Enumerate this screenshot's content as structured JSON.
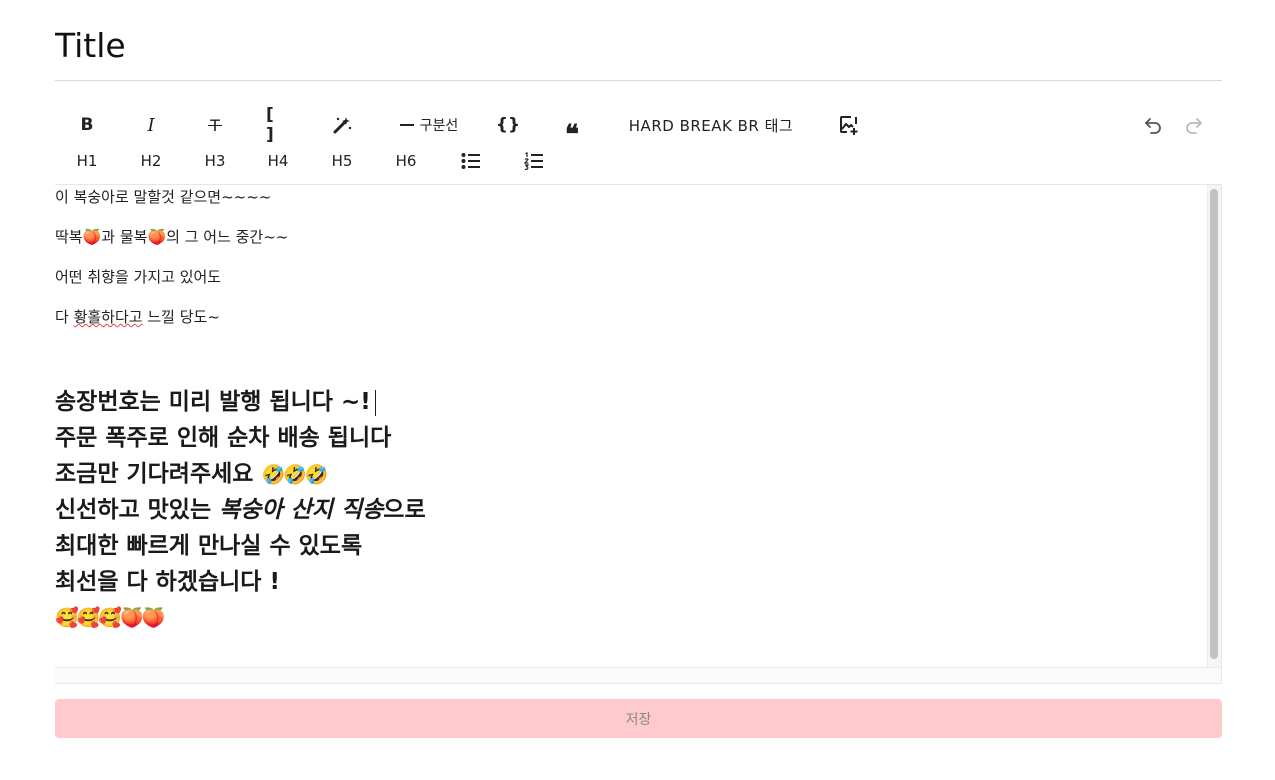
{
  "title_field": {
    "value": "Title"
  },
  "toolbar": {
    "bold": "B",
    "italic": "I",
    "strike": "T",
    "brackets": "[ ]",
    "divider": "구분선",
    "code": "{}",
    "quote": "❝",
    "hard_break": "HARD BREAK BR 태그",
    "headings": [
      "H1",
      "H2",
      "H3",
      "H4",
      "H5",
      "H6"
    ]
  },
  "editor": {
    "paragraphs": [
      "이 복숭아로 말할것 같으면~~~~",
      "딱복🍑과 물복🍑의 그 어느 중간~~",
      "어떤 취향을 가지고 있어도"
    ],
    "p4_pre": "다 ",
    "p4_spell": "황홀하다고",
    "p4_post": " 느낄 당도~",
    "bold_lines": {
      "l1": "송장번호는 미리 발행 됩니다 ~!",
      "l2": "주문 폭주로 인해 순차 배송 됩니다",
      "l3_text": "조금만 기다려주세요 ",
      "l3_emoji": "🤣🤣🤣",
      "l4_pre": "신선하고 맛있는 ",
      "l4_italic": "복숭아 산지 직송",
      "l4_post": "으로",
      "l5": "최대한 빠르게 만나실 수 있도록",
      "l6": "최선을 다 하겠습니다 !",
      "l7_emoji": "🥰🥰🥰🍑🍑"
    }
  },
  "save_button": {
    "label": "저장"
  },
  "colors": {
    "save_bg": "#fecacb",
    "save_text": "#8a8a8a",
    "divider": "#d9d9d9"
  }
}
